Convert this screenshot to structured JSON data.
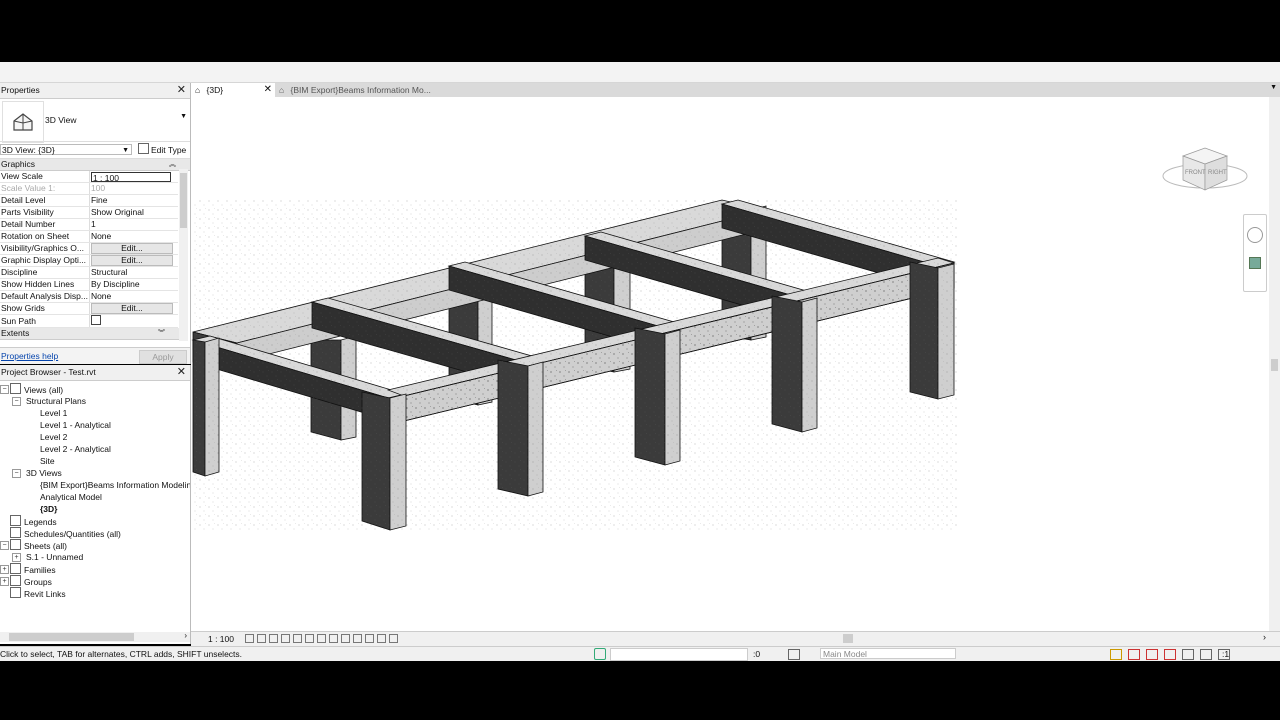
{
  "properties": {
    "title": "Properties",
    "type_name": "3D View",
    "view_selector": "3D View: {3D}",
    "edit_type": "Edit Type",
    "section_graphics": "Graphics",
    "rows": [
      {
        "k": "View Scale",
        "v": "1 : 100",
        "kind": "input"
      },
      {
        "k": "Scale Value    1:",
        "v": "100",
        "kind": "dim"
      },
      {
        "k": "Detail Level",
        "v": "Fine"
      },
      {
        "k": "Parts Visibility",
        "v": "Show Original"
      },
      {
        "k": "Detail Number",
        "v": "1"
      },
      {
        "k": "Rotation on Sheet",
        "v": "None"
      },
      {
        "k": "Visibility/Graphics O...",
        "v": "Edit...",
        "kind": "button"
      },
      {
        "k": "Graphic Display Opti...",
        "v": "Edit...",
        "kind": "button"
      },
      {
        "k": "Discipline",
        "v": "Structural"
      },
      {
        "k": "Show Hidden Lines",
        "v": "By Discipline"
      },
      {
        "k": "Default Analysis Disp...",
        "v": "None"
      },
      {
        "k": "Show Grids",
        "v": "Edit...",
        "kind": "button"
      },
      {
        "k": "Sun Path",
        "v": "",
        "kind": "checkbox"
      }
    ],
    "section_extents": "Extents",
    "help_link": "Properties help",
    "apply": "Apply"
  },
  "browser": {
    "title": "Project Browser - Test.rvt",
    "nodes": [
      {
        "label": "Views (all)",
        "level": 0,
        "exp": "-",
        "icon": true
      },
      {
        "label": "Structural Plans",
        "level": 1,
        "exp": "-"
      },
      {
        "label": "Level 1",
        "level": 2
      },
      {
        "label": "Level 1 - Analytical",
        "level": 2
      },
      {
        "label": "Level 2",
        "level": 2
      },
      {
        "label": "Level 2 - Analytical",
        "level": 2
      },
      {
        "label": "Site",
        "level": 2
      },
      {
        "label": "3D Views",
        "level": 1,
        "exp": "-"
      },
      {
        "label": "{BIM Export}Beams Information Modeling",
        "level": 2
      },
      {
        "label": "Analytical Model",
        "level": 2
      },
      {
        "label": "{3D}",
        "level": 2,
        "bold": true
      },
      {
        "label": "Legends",
        "level": 0,
        "icon": true
      },
      {
        "label": "Schedules/Quantities (all)",
        "level": 0,
        "icon": true
      },
      {
        "label": "Sheets (all)",
        "level": 0,
        "exp": "-",
        "icon": true
      },
      {
        "label": "S.1 - Unnamed",
        "level": 1,
        "exp": "+"
      },
      {
        "label": "Families",
        "level": 0,
        "exp": "+",
        "icon": true
      },
      {
        "label": "Groups",
        "level": 0,
        "exp": "+",
        "icon": true
      },
      {
        "label": "Revit Links",
        "level": 0,
        "icon": true
      }
    ]
  },
  "tabs": [
    {
      "label": "{3D}",
      "active": true
    },
    {
      "label": "{BIM Export}Beams Information Mo...",
      "active": false
    }
  ],
  "viewcube": {
    "front": "FRONT",
    "right": "RIGHT"
  },
  "view_control": {
    "scale": "1 : 100"
  },
  "status": {
    "message": "Click to select, TAB for alternates, CTRL adds, SHIFT unselects.",
    "filter_count": ":0",
    "model": "Main Model",
    "sel_count": ":1"
  }
}
